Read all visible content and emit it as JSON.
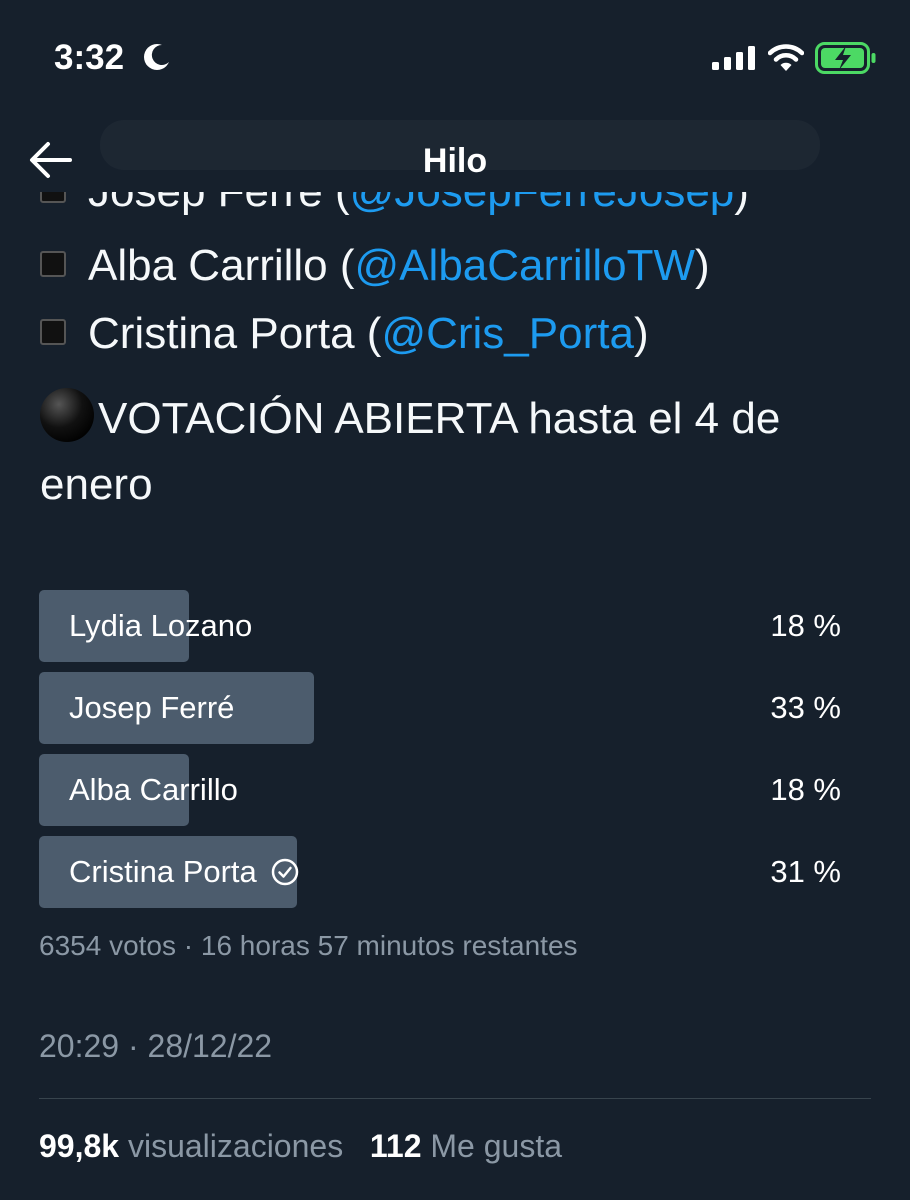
{
  "status_bar": {
    "time": "3:32"
  },
  "header": {
    "title": "Hilo"
  },
  "tweet": {
    "mentions": [
      {
        "name": "Josep Ferré",
        "open": " (",
        "handle": "@JosepFerreJosep",
        "close": ")"
      },
      {
        "name": "Alba Carrillo",
        "open": " (",
        "handle": "@AlbaCarrilloTW",
        "close": ")"
      },
      {
        "name": "Cristina Porta",
        "open": " (",
        "handle": "@Cris_Porta",
        "close": ")"
      }
    ],
    "headline": "VOTACIÓN ABIERTA hasta el 4 de enero"
  },
  "poll": {
    "options": [
      {
        "label": "Lydia Lozano",
        "percent_text": "18 %",
        "percent": 18,
        "selected": false
      },
      {
        "label": "Josep Ferré",
        "percent_text": "33 %",
        "percent": 33,
        "selected": false
      },
      {
        "label": "Alba Carrillo",
        "percent_text": "18 %",
        "percent": 18,
        "selected": false
      },
      {
        "label": "Cristina Porta",
        "percent_text": "31 %",
        "percent": 31,
        "selected": true
      }
    ],
    "meta": "6354 votos · 16 horas 57 minutos restantes"
  },
  "timestamp": "20:29 · 28/12/22",
  "stats": {
    "views_count": "99,8k",
    "views_label": " visualizaciones",
    "likes_count": "112",
    "likes_label": " Me gusta"
  },
  "colors": {
    "background": "#16202c",
    "link": "#1d9bf0",
    "poll_bar": "#4c5c6d",
    "muted": "#8b98a5",
    "battery": "#4cd964"
  }
}
